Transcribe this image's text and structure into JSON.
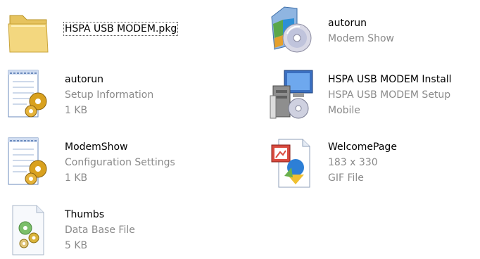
{
  "files": [
    {
      "name": "HSPA USB MODEM.pkg",
      "details": [],
      "icon": "folder-icon"
    },
    {
      "name": "autorun",
      "details": [
        "Modem Show"
      ],
      "icon": "cd-installer-icon"
    },
    {
      "name": "autorun",
      "details": [
        "Setup Information",
        "1 KB"
      ],
      "icon": "setup-info-file-icon"
    },
    {
      "name": "HSPA USB MODEM Install",
      "details": [
        "HSPA USB MODEM Setup",
        "Mobile"
      ],
      "icon": "computer-installer-icon"
    },
    {
      "name": "ModemShow",
      "details": [
        "Configuration Settings",
        "1 KB"
      ],
      "icon": "config-settings-file-icon"
    },
    {
      "name": "WelcomePage",
      "details": [
        "183 x 330",
        "GIF File"
      ],
      "icon": "gif-image-file-icon"
    },
    {
      "name": "Thumbs",
      "details": [
        "Data Base File",
        "5 KB"
      ],
      "icon": "database-file-icon"
    }
  ],
  "colors": {
    "folder": "#f3d77f",
    "meta_text": "#8a8a8a"
  }
}
